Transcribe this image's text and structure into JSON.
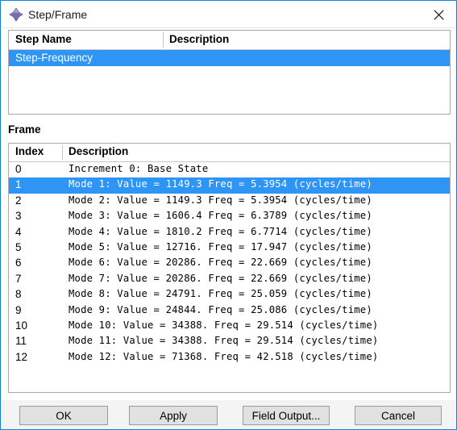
{
  "window": {
    "title": "Step/Frame",
    "icon": "abaqus-diamond-icon",
    "close_label": "×",
    "accent_color": "#2e95f5",
    "border_color": "#0a84e0"
  },
  "step_section": {
    "columns": [
      "Step Name",
      "Description"
    ],
    "rows": [
      {
        "name": "Step-Frequency",
        "description": "",
        "selected": true
      }
    ]
  },
  "frame_section": {
    "label": "Frame",
    "columns": [
      "Index",
      "Description"
    ],
    "rows": [
      {
        "index": "0",
        "description": "Increment      0: Base State",
        "selected": false
      },
      {
        "index": "1",
        "description": "Mode           1: Value =   1149.3   Freq =   5.3954    (cycles/time)",
        "selected": true
      },
      {
        "index": "2",
        "description": "Mode           2: Value =   1149.3   Freq =   5.3954    (cycles/time)",
        "selected": false
      },
      {
        "index": "3",
        "description": "Mode           3: Value =   1606.4   Freq =   6.3789    (cycles/time)",
        "selected": false
      },
      {
        "index": "4",
        "description": "Mode           4: Value =   1810.2   Freq =   6.7714    (cycles/time)",
        "selected": false
      },
      {
        "index": "5",
        "description": "Mode           5: Value =   12716.   Freq =   17.947    (cycles/time)",
        "selected": false
      },
      {
        "index": "6",
        "description": "Mode           6: Value =   20286.   Freq =   22.669    (cycles/time)",
        "selected": false
      },
      {
        "index": "7",
        "description": "Mode           7: Value =   20286.   Freq =   22.669    (cycles/time)",
        "selected": false
      },
      {
        "index": "8",
        "description": "Mode           8: Value =   24791.   Freq =   25.059    (cycles/time)",
        "selected": false
      },
      {
        "index": "9",
        "description": "Mode           9: Value =   24844.   Freq =   25.086    (cycles/time)",
        "selected": false
      },
      {
        "index": "10",
        "description": "Mode          10: Value =   34388.   Freq =   29.514    (cycles/time)",
        "selected": false
      },
      {
        "index": "11",
        "description": "Mode          11: Value =   34388.   Freq =   29.514    (cycles/time)",
        "selected": false
      },
      {
        "index": "12",
        "description": "Mode          12: Value =   71368.   Freq =   42.518    (cycles/time)",
        "selected": false
      }
    ]
  },
  "buttons": {
    "ok": "OK",
    "apply": "Apply",
    "field_output": "Field Output...",
    "cancel": "Cancel"
  }
}
